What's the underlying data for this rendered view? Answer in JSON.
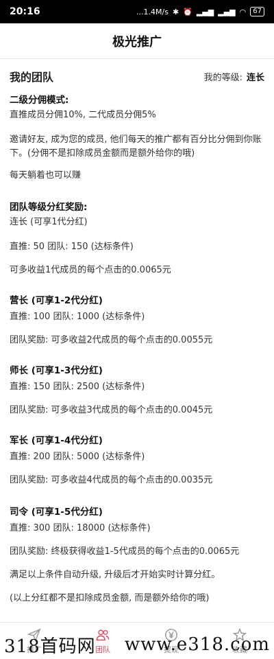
{
  "status_bar": {
    "time": "20:16",
    "network": "...1.4M/s",
    "battery": "67"
  },
  "header": {
    "title": "极光推广"
  },
  "team": {
    "title": "我的团队",
    "level_label": "我的等级:",
    "level_value": "连长"
  },
  "sections": {
    "commission_title": "二级分佣模式:",
    "commission_rate": "直推成员分佣10%, 二代成员分佣5%",
    "invite_text": "邀请好友, 成为您的成员, 他们每天的推广都有百分比分佣到你账下。(分佣不是扣除成员金额而是额外给你的哦)",
    "lie_earn": "每天躺着也可以赚",
    "bonus_title": "团队等级分红奖励:",
    "lianzhang_title": "连长 (可享1代分红)",
    "lianzhang_cond": "直推: 50 团队: 150 (达标条件)",
    "lianzhang_bonus": "可多收益1代成员的每个点击的0.0065元",
    "yingzhang_title": "营长 (可享1-2代分红)",
    "yingzhang_cond": "直推: 100 团队: 1000 (达标条件)",
    "yingzhang_bonus": "团队奖励: 可多收益2代成员的每个点击的0.0055元",
    "shizhang_title": "师长 (可享1-3代分红)",
    "shizhang_cond": "直推: 150 团队: 2500 (达标条件)",
    "shizhang_bonus": "团队奖励: 可多收益3代成员的每个点击的0.0045元",
    "junzhang_title": "军长 (可享1-4代分红)",
    "junzhang_cond": "直推: 200 团队: 5000 (达标条件)",
    "junzhang_bonus": "团队奖励: 可多收益4代成员的每个点击的0.0035元",
    "siling_title": "司令 (可享1-5代分红)",
    "siling_cond": "直推: 300 团队: 18000 (达标条件)",
    "siling_bonus": "团队奖励: 终极获得收益1-5代成员的每个点击的0.0065元",
    "auto_upgrade": "满足以上条件自动升级, 升级后才开始实时计算分红。",
    "note": "(以上分红都不是扣除成员金额, 而是额外给你的哦)"
  },
  "bottom_nav": {
    "items": [
      {
        "label": "推广",
        "icon": "send-icon"
      },
      {
        "label": "团队",
        "icon": "team-icon"
      },
      {
        "label": "提现",
        "icon": "yen-icon"
      },
      {
        "label": "收藏",
        "icon": "star-icon"
      }
    ],
    "active_color": "#e84a5f"
  },
  "watermark": {
    "left": "318首码网",
    "right": "www.e318.com"
  }
}
